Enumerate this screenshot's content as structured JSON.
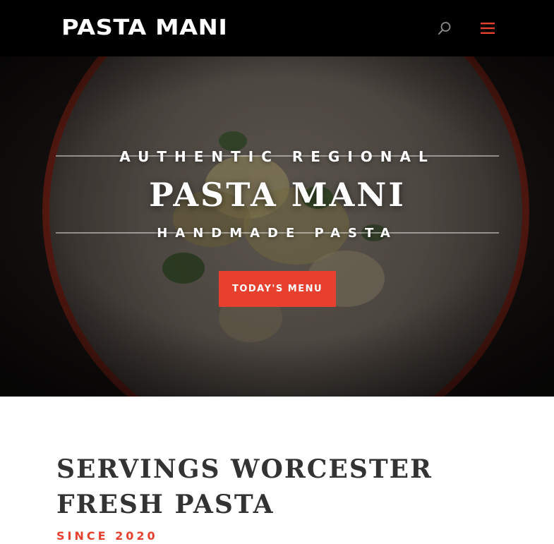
{
  "header": {
    "logo": "PASTA MANI",
    "icons": [
      "search-icon",
      "hamburger-menu-icon"
    ]
  },
  "hero": {
    "kicker": "AUTHENTIC REGIONAL",
    "title": "PASTA MANI",
    "subtitle": "HANDMADE PASTA",
    "cta_label": "TODAY'S MENU"
  },
  "content": {
    "heading_line1": "SERVINGS WORCESTER",
    "heading_line2": "FRESH PASTA",
    "since": "SINCE 2020"
  },
  "colors": {
    "accent": "#e8402f",
    "header_bg": "#000000",
    "heading_text": "#333333"
  }
}
